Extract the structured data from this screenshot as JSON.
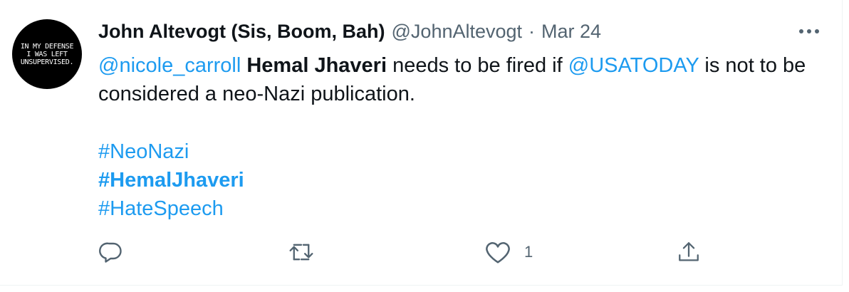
{
  "avatar": {
    "lines": [
      "IN MY DEFENSE",
      "I WAS LEFT",
      "UNSUPERVISED."
    ]
  },
  "tweet": {
    "author_name": "John Altevogt (Sis, Boom, Bah)",
    "handle": "@JohnAltevogt",
    "separator": "·",
    "date": "Mar 24",
    "text": {
      "mention1": "@nicole_carroll",
      "name_bold": "Hemal Jhaveri",
      "middle": " needs to be fired if ",
      "mention2": "@USATODAY",
      "end": " is not to be considered a neo-Nazi publication."
    },
    "hashtags": [
      "#NeoNazi",
      "#HemalJhaveri",
      "#HateSpeech"
    ],
    "likes": "1"
  },
  "icons": {
    "more": "more-horizontal-icon",
    "reply": "reply-icon",
    "retweet": "retweet-icon",
    "like": "heart-icon",
    "share": "share-icon"
  },
  "colors": {
    "link": "#1d9bf0",
    "text": "#0f1419",
    "secondary": "#536471"
  }
}
